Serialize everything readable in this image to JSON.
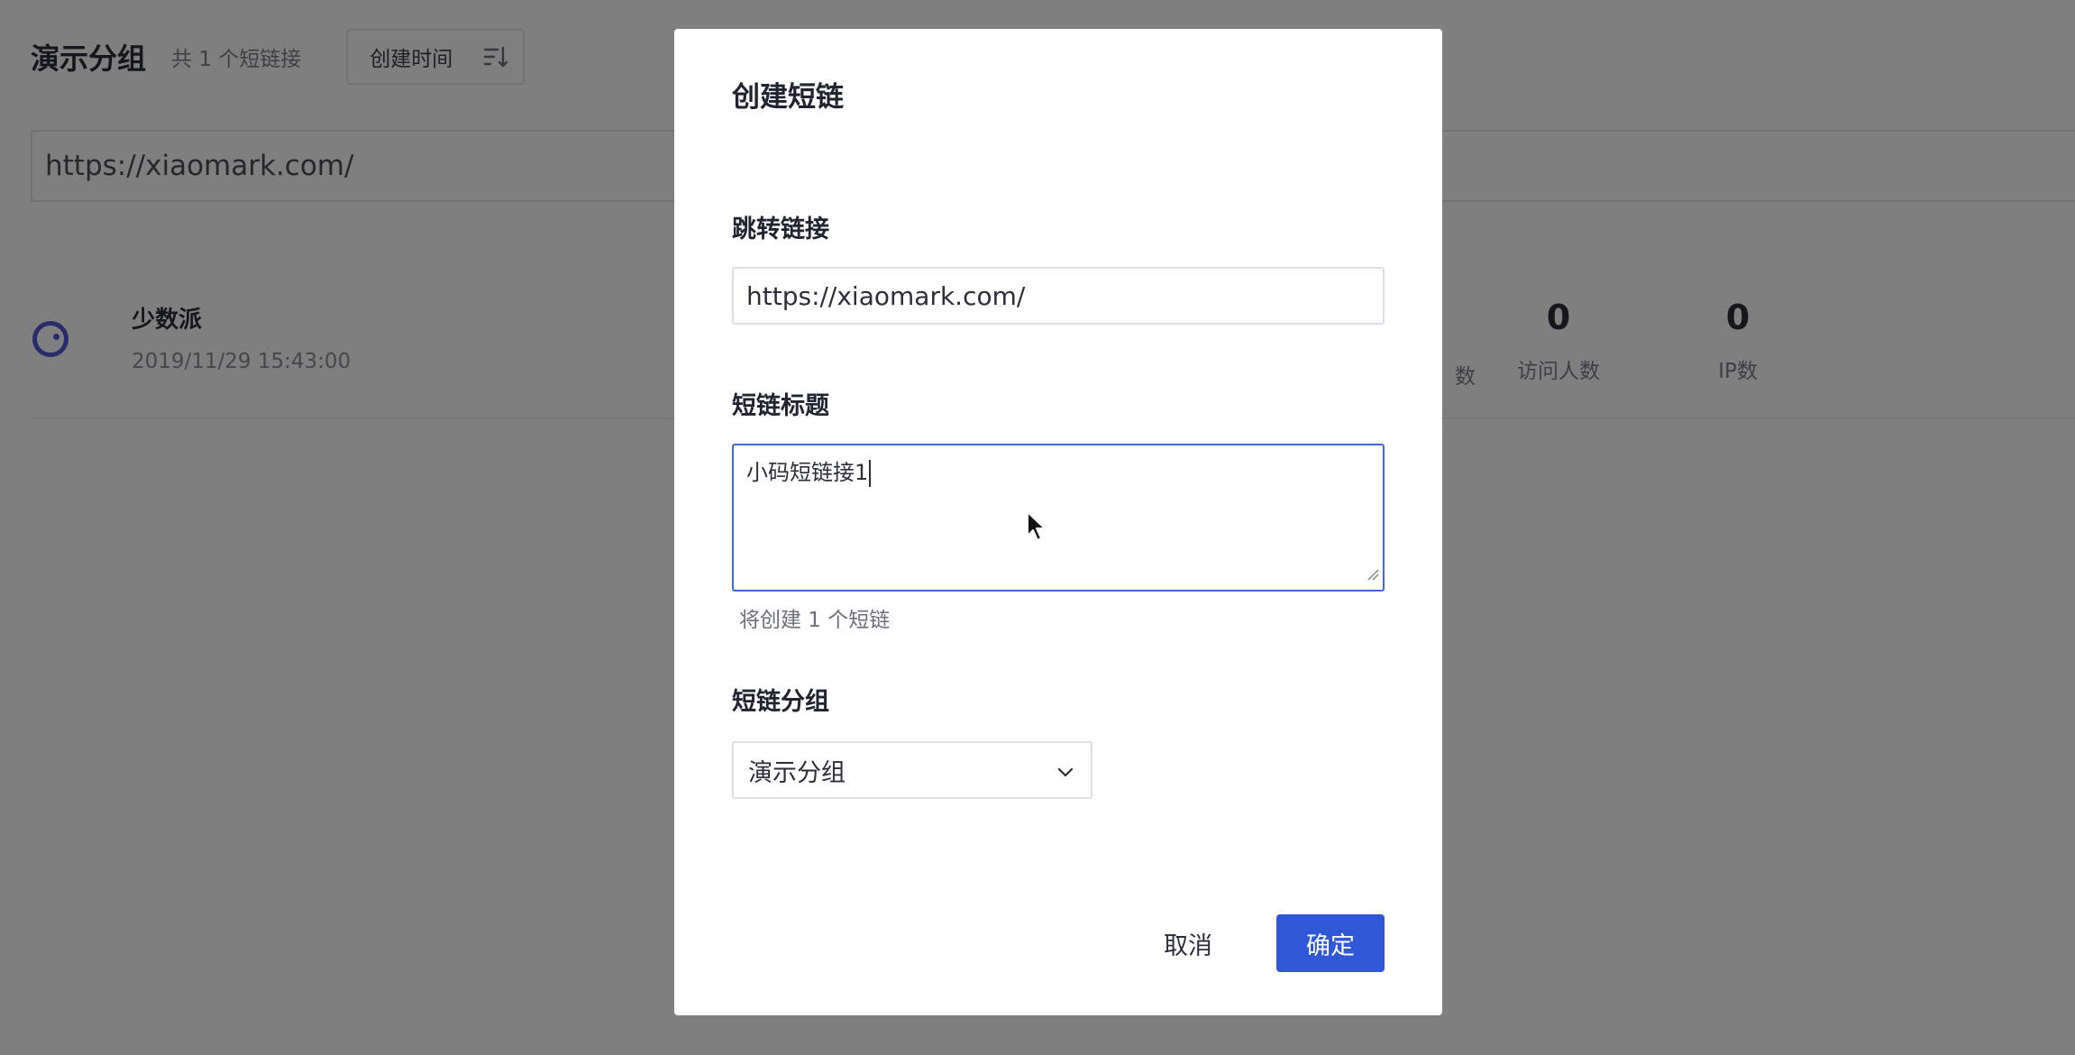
{
  "background": {
    "group_title": "演示分组",
    "group_count": "共 1 个短链接",
    "sort_label": "创建时间",
    "url_input_value": "https://xiaomark.com/",
    "link": {
      "title": "少数派",
      "created_at": "2019/11/29 15:43:00",
      "partial_stat_label": "数",
      "visitors_value": "0",
      "visitors_label": "访问人数",
      "ip_value": "0",
      "ip_label": "IP数"
    }
  },
  "modal": {
    "title": "创建短链",
    "redirect_label": "跳转链接",
    "redirect_value": "https://xiaomark.com/",
    "short_title_label": "短链标题",
    "short_title_value": "小码短链接1",
    "hint": "将创建 1 个短链",
    "group_label": "短链分组",
    "group_value": "演示分组",
    "cancel_label": "取消",
    "confirm_label": "确定"
  },
  "colors": {
    "primary": "#2f57d6",
    "focus_border": "#3d6ad6",
    "status_ring": "#4f5ad8"
  },
  "icons": [
    "sort-icon",
    "status-ring-icon",
    "chevron-down-icon",
    "resize-grip-icon",
    "mouse-cursor-icon"
  ]
}
